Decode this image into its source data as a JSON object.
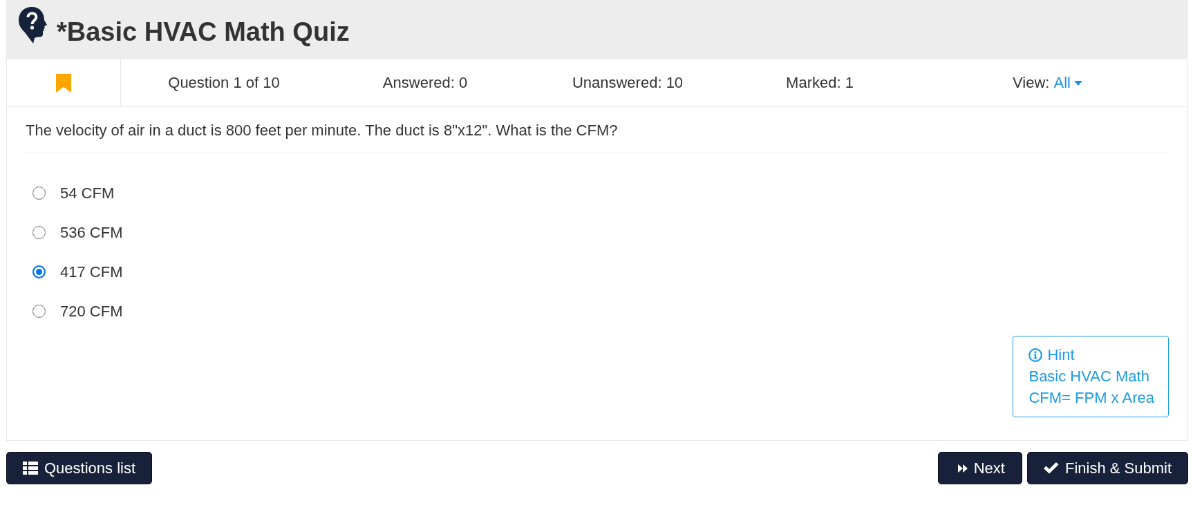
{
  "header": {
    "title": "*Basic HVAC Math Quiz"
  },
  "status_bar": {
    "bookmarked": true,
    "counters": [
      "Question 1 of 10",
      "Answered: 0",
      "Unanswered: 10",
      "Marked: 1"
    ],
    "view": {
      "label": "View:",
      "value": "All"
    }
  },
  "question": {
    "text": "The velocity of air in a duct is 800 feet per minute. The duct is 8\"x12\". What is the CFM?",
    "options": [
      {
        "label": "54 CFM",
        "selected": false
      },
      {
        "label": "536 CFM",
        "selected": false
      },
      {
        "label": "417 CFM",
        "selected": true
      },
      {
        "label": "720 CFM",
        "selected": false
      }
    ]
  },
  "hint": {
    "title": "Hint",
    "lines": [
      "Basic HVAC Math",
      "CFM= FPM x Area"
    ]
  },
  "footer": {
    "left_buttons": [
      {
        "kind": "list",
        "label": "Questions list"
      }
    ],
    "right_buttons": [
      {
        "kind": "next",
        "label": "Next"
      },
      {
        "kind": "submit",
        "label": "Finish & Submit"
      }
    ]
  }
}
